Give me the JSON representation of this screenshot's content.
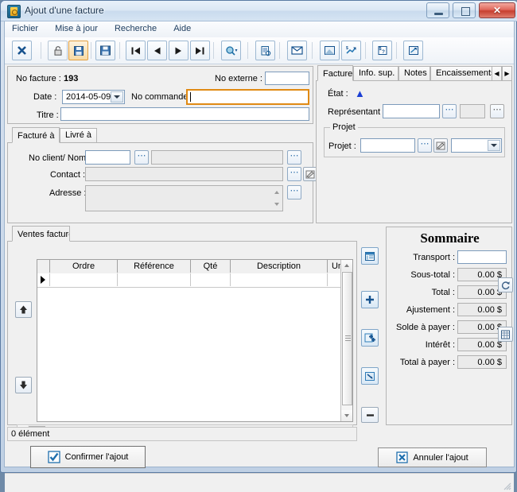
{
  "window": {
    "title": "Ajout d'une facture",
    "icon": "app-icon",
    "buttons": {
      "minimize": "–",
      "restore": "□",
      "close": "✕"
    }
  },
  "menu": {
    "items": [
      "Fichier",
      "Mise à jour",
      "Recherche",
      "Aide"
    ]
  },
  "toolbar": {
    "buttons": [
      {
        "name": "close-record",
        "glyph": "✖"
      },
      {
        "name": "lock",
        "glyph": "lock"
      },
      {
        "name": "save-orange",
        "glyph": "save"
      },
      {
        "name": "save-blue",
        "glyph": "disk"
      },
      {
        "name": "first-record",
        "glyph": "⏮"
      },
      {
        "name": "previous-record",
        "glyph": "◀"
      },
      {
        "name": "next-record",
        "glyph": "▶"
      },
      {
        "name": "last-record",
        "glyph": "⏭"
      },
      {
        "name": "search-dropdown",
        "glyph": "search"
      },
      {
        "name": "report",
        "glyph": "report"
      },
      {
        "name": "email",
        "glyph": "✉"
      },
      {
        "name": "preview",
        "glyph": "preview"
      },
      {
        "name": "payment",
        "glyph": "payment"
      },
      {
        "name": "price-query",
        "glyph": "price"
      },
      {
        "name": "export",
        "glyph": "export"
      }
    ]
  },
  "header": {
    "no_facture_label": "No facture :",
    "no_facture_value": "193",
    "no_externe_label": "No externe :",
    "no_externe_value": "",
    "date_label": "Date :",
    "date_value": "2014-05-09",
    "no_commande_label": "No commande :",
    "no_commande_value": "",
    "titre_label": "Titre :",
    "titre_value": ""
  },
  "billing": {
    "tabs": [
      {
        "label": "Facturé à",
        "selected": true
      },
      {
        "label": "Livré à",
        "selected": false
      }
    ],
    "no_client_label": "No client/ Nom :",
    "no_client_value": "",
    "client_name_value": "",
    "contact_label": "Contact :",
    "contact_value": "",
    "adresse_label": "Adresse :",
    "adresse_value": ""
  },
  "right_panel": {
    "tabs": [
      {
        "label": "Facture",
        "selected": true
      },
      {
        "label": "Info. sup.",
        "selected": false
      },
      {
        "label": "Notes",
        "selected": false
      },
      {
        "label": "Encaissements/Rembo",
        "selected": false
      }
    ],
    "scroll_left": "◀",
    "scroll_right": "▶",
    "etat_label": "État :",
    "etat_value": "▲",
    "etat_color": "#1b3fd4",
    "representant_label": "Représentant :",
    "representant_value": "",
    "representant_value2": "",
    "projet_group_title": "Projet",
    "projet_label": "Projet :",
    "projet_value": "",
    "projet_combo_value": ""
  },
  "sales": {
    "tab_label": "Ventes facture",
    "columns": [
      "Ordre",
      "Référence",
      "Qté",
      "Description",
      "Un"
    ],
    "rows": [
      {
        "Ordre": "",
        "Référence": "",
        "Qté": "",
        "Description": "",
        "Un": "",
        "selected": true
      }
    ],
    "status": "0 élément",
    "side_buttons": [
      {
        "name": "move-up",
        "glyph": "▲"
      },
      {
        "name": "move-down",
        "glyph": "▼"
      }
    ],
    "action_buttons": [
      {
        "name": "detail-lines",
        "glyph": "list"
      },
      {
        "name": "add-line",
        "glyph": "+"
      },
      {
        "name": "add-multiple-lines",
        "glyph": "++"
      },
      {
        "name": "import-lines",
        "glyph": "import"
      },
      {
        "name": "delete-line",
        "glyph": "–"
      }
    ]
  },
  "summary": {
    "title": "Sommaire",
    "rows": [
      {
        "label": "Transport :",
        "value": "",
        "editable": true
      },
      {
        "label": "Sous-total :",
        "value": "0.00 $",
        "editable": false
      },
      {
        "label": "Total :",
        "value": "0.00 $",
        "editable": false
      },
      {
        "label": "Ajustement :",
        "value": "0.00 $",
        "editable": false
      },
      {
        "label": "Solde à payer :",
        "value": "0.00 $",
        "editable": false
      },
      {
        "label": "Intérêt :",
        "value": "0.00 $",
        "editable": false
      },
      {
        "label": "Total à payer :",
        "value": "0.00 $",
        "editable": false
      }
    ],
    "refresh_button": "refresh-icon",
    "table_button": "table-icon"
  },
  "footer": {
    "confirm_label": "Confirmer l'ajout",
    "cancel_label": "Annuler l'ajout"
  }
}
